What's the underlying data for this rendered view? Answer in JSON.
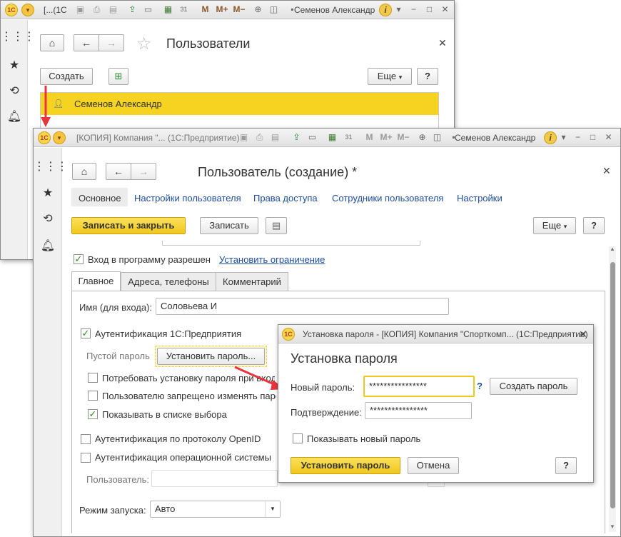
{
  "window1": {
    "title_short": "[КОПИЯ] Компания ... (1С",
    "title_visible": "[...(1С",
    "user_name": "Семенов Александр",
    "form_title": "Пользователи",
    "create_button": "Создать",
    "more_button": "Еще",
    "help_button": "?",
    "list_rows": [
      {
        "name": "Семенов Александр",
        "selected": true
      }
    ]
  },
  "window2": {
    "title": "[КОПИЯ] Компания \"... (1С:Предприятие)",
    "user_name": "Семенов Александр",
    "form_title": "Пользователь (создание) *",
    "section_tabs": [
      "Основное",
      "Настройки пользователя",
      "Права доступа",
      "Сотрудники пользователя",
      "Настройки"
    ],
    "save_close_button": "Записать и закрыть",
    "save_button": "Записать",
    "more_button": "Еще",
    "help_button": "?",
    "login_allowed_label": "Вход в программу разрешен",
    "set_restriction_link": "Установить ограничение",
    "tabs": [
      "Главное",
      "Адреса, телефоны",
      "Комментарий"
    ],
    "login_name_label": "Имя (для входа):",
    "login_name_value": "Соловьева И",
    "auth_1c_label": "Аутентификация 1С:Предприятия",
    "empty_password_label": "Пустой пароль",
    "set_password_button": "Установить пароль...",
    "require_password_change_label": "Потребовать установку пароля при входе",
    "forbid_password_change_label": "Пользователю запрещено изменять пароль",
    "show_in_list_label": "Показывать в списке выбора",
    "openid_label": "Аутентификация по протоколу OpenID",
    "os_auth_label": "Аутентификация операционной системы",
    "os_user_label": "Пользователь:",
    "launch_mode_label": "Режим запуска:",
    "launch_mode_value": "Авто"
  },
  "dialog": {
    "title": "Установка пароля - [КОПИЯ] Компания \"Спорткомп... (1С:Предприятие)",
    "heading": "Установка пароля",
    "new_password_label": "Новый пароль:",
    "new_password_value": "****************",
    "help_link": "?",
    "generate_button": "Создать пароль",
    "confirm_label": "Подтверждение:",
    "confirm_value": "****************",
    "show_password_label": "Показывать новый пароль",
    "set_button": "Установить пароль",
    "cancel_button": "Отмена",
    "help_button": "?"
  },
  "colors": {
    "accent_yellow": "#f0c81e",
    "selected_row": "#f5d320",
    "link_blue": "#1f4ea1",
    "arrow_red": "#e8343c"
  },
  "icons": {
    "toolbar": [
      "logo-1c-icon",
      "main-menu-icon",
      "save-icon",
      "print-icon",
      "attach-icon",
      "calculator-icon",
      "calendar-icon",
      "memory-icon",
      "zoom-icon",
      "panel-icon",
      "info-icon"
    ],
    "sidebar": [
      "apps-grid-icon",
      "star-icon",
      "history-icon",
      "bell-icon"
    ]
  }
}
